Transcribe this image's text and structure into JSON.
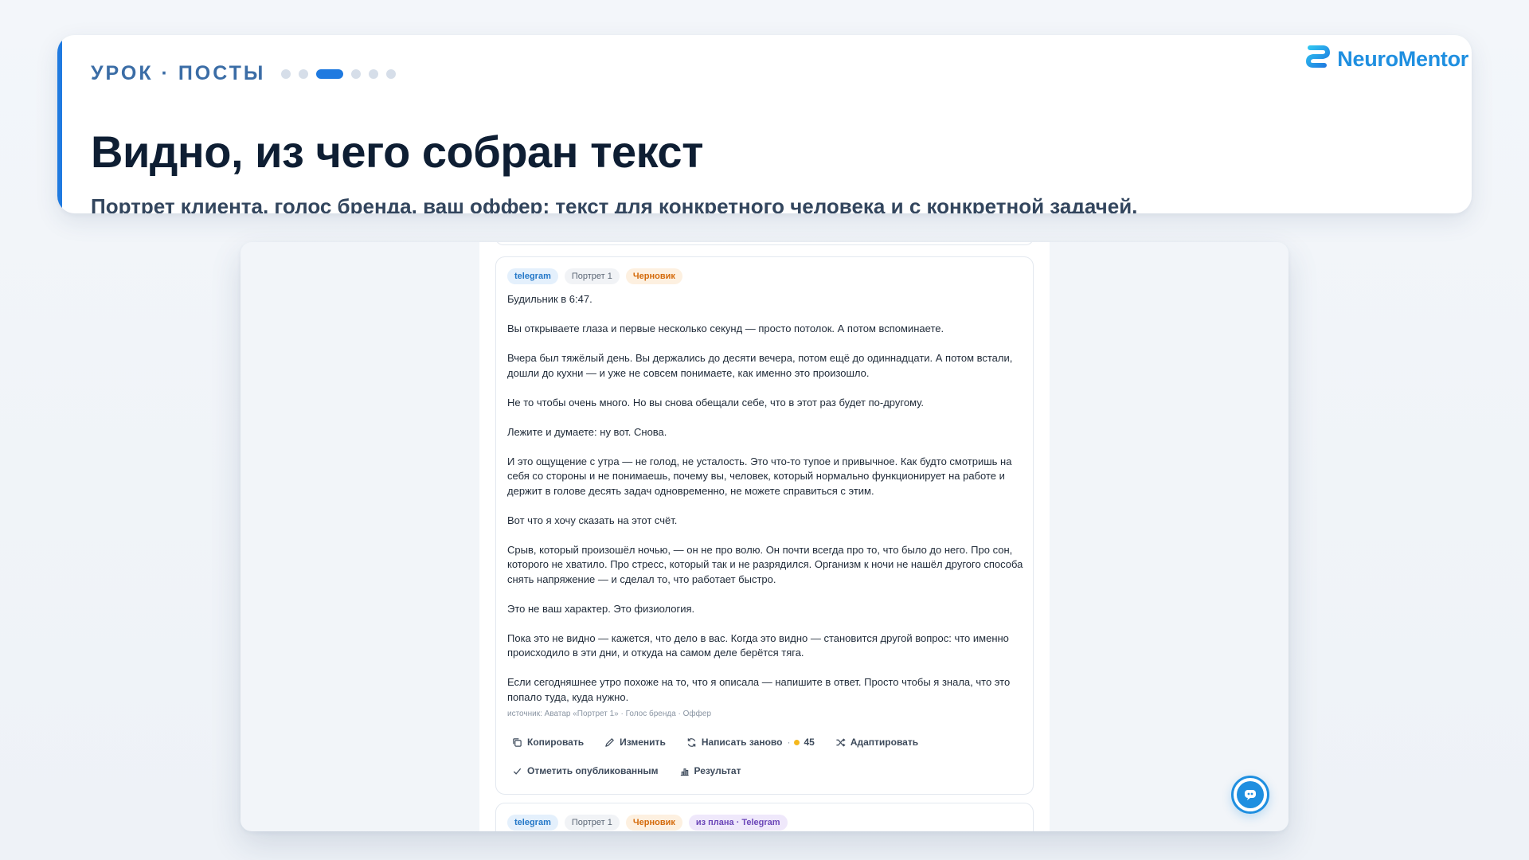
{
  "header": {
    "lesson_label": "УРОК · ПОСТЫ",
    "progress": {
      "total_steps": 7,
      "current_step": 3
    },
    "title": "Видно, из чего собран текст",
    "subtitle": "Портрет клиента, голос бренда, ваш оффер: текст для конкретного человека и с конкретной задачей.",
    "brand_name": "NeuroMentor"
  },
  "colors": {
    "accent": "#1f7ae0",
    "brand": "#1f8fe0",
    "status_draft": "#d46a0a",
    "plan_tag": "#6b46b8"
  },
  "post": {
    "tags": {
      "platform": "telegram",
      "portrait": "Портрет 1",
      "status": "Черновик"
    },
    "paragraphs": [
      "Будильник в 6:47.",
      "Вы открываете глаза и первые несколько секунд — просто потолок. А потом вспоминаете.",
      "Вчера был тяжёлый день. Вы держались до десяти вечера, потом ещё до одиннадцати. А потом встали, дошли до кухни — и уже не совсем понимаете, как именно это произошло.",
      "Не то чтобы очень много. Но вы снова обещали себе, что в этот раз будет по-другому.",
      "Лежите и думаете: ну вот. Снова.",
      "И это ощущение с утра — не голод, не усталость. Это что-то тупое и привычное. Как будто смотришь на себя со стороны и не понимаешь, почему вы, человек, который нормально функционирует на работе и держит в голове десять задач одновременно, не можете справиться с этим.",
      "Вот что я хочу сказать на этот счёт.",
      "Срыв, который произошёл ночью, — он не про волю. Он почти всегда про то, что было до него. Про сон, которого не хватило. Про стресс, который так и не разрядился. Организм к ночи не нашёл другого способа снять напряжение — и сделал то, что работает быстро.",
      "Это не ваш характер. Это физиология.",
      "Пока это не видно — кажется, что дело в вас. Когда это видно — становится другой вопрос: что именно происходило в эти дни, и откуда на самом деле берётся тяга.",
      "Если сегодняшнее утро похоже на то, что я описала — напишите в ответ. Просто чтобы я знала, что это попало туда, куда нужно."
    ],
    "source": "источник: Аватар «Портрет 1» · Голос бренда · Оффер",
    "actions": {
      "copy": "Копировать",
      "edit": "Изменить",
      "rewrite": "Написать заново",
      "rewrite_separator": "·",
      "rewrite_cost": "45",
      "adapt": "Адаптировать",
      "mark_published": "Отметить опубликованным",
      "result": "Результат"
    }
  },
  "next_post": {
    "tags": {
      "platform": "telegram",
      "portrait": "Портрет 1",
      "status": "Черновик",
      "plan": "из плана · Telegram"
    }
  },
  "icons": {
    "copy": "copy-icon",
    "edit": "pencil-icon",
    "rewrite": "refresh-icon",
    "adapt": "shuffle-icon",
    "mark_published": "check-icon",
    "result": "bar-chart-icon",
    "chat": "chat-bot-icon",
    "brand": "brand-logo-icon"
  }
}
